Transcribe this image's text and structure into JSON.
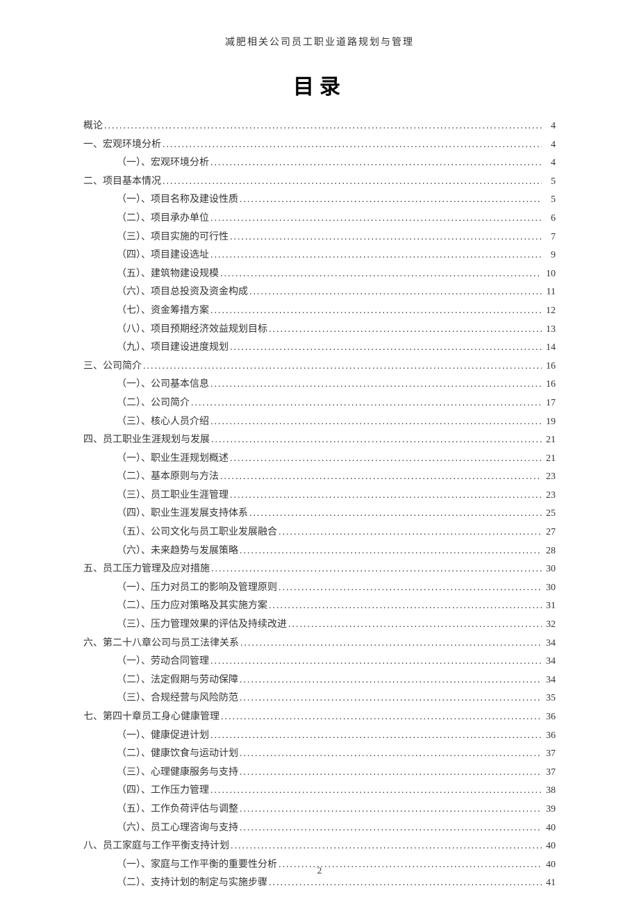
{
  "header_title": "减肥相关公司员工职业道路规划与管理",
  "main_title": "目录",
  "page_number": "2",
  "toc": [
    {
      "level": 0,
      "label": "概论",
      "page": "4"
    },
    {
      "level": 0,
      "label": "一、宏观环境分析",
      "page": "4"
    },
    {
      "level": 1,
      "label": "（一）、宏观环境分析",
      "page": "4"
    },
    {
      "level": 0,
      "label": "二、项目基本情况",
      "page": "5"
    },
    {
      "level": 1,
      "label": "（一）、项目名称及建设性质",
      "page": "5"
    },
    {
      "level": 1,
      "label": "（二）、项目承办单位",
      "page": "6"
    },
    {
      "level": 1,
      "label": "（三）、项目实施的可行性",
      "page": "7"
    },
    {
      "level": 1,
      "label": "（四）、项目建设选址",
      "page": "9"
    },
    {
      "level": 1,
      "label": "（五）、建筑物建设规模",
      "page": "10"
    },
    {
      "level": 1,
      "label": "（六）、项目总投资及资金构成",
      "page": "11"
    },
    {
      "level": 1,
      "label": "（七）、资金筹措方案",
      "page": "12"
    },
    {
      "level": 1,
      "label": "（八）、项目预期经济效益规划目标",
      "page": "13"
    },
    {
      "level": 1,
      "label": "（九）、项目建设进度规划",
      "page": "14"
    },
    {
      "level": 0,
      "label": "三、公司简介",
      "page": "16"
    },
    {
      "level": 1,
      "label": "（一）、公司基本信息",
      "page": "16"
    },
    {
      "level": 1,
      "label": "（二）、公司简介",
      "page": "17"
    },
    {
      "level": 1,
      "label": "（三）、核心人员介绍",
      "page": "19"
    },
    {
      "level": 0,
      "label": "四、员工职业生涯规划与发展",
      "page": "21"
    },
    {
      "level": 1,
      "label": "（一）、职业生涯规划概述",
      "page": "21"
    },
    {
      "level": 1,
      "label": "（二）、基本原则与方法",
      "page": "23"
    },
    {
      "level": 1,
      "label": "（三）、员工职业生涯管理",
      "page": "23"
    },
    {
      "level": 1,
      "label": "（四）、职业生涯发展支持体系",
      "page": "25"
    },
    {
      "level": 1,
      "label": "（五）、公司文化与员工职业发展融合",
      "page": "27"
    },
    {
      "level": 1,
      "label": "（六）、未来趋势与发展策略",
      "page": "28"
    },
    {
      "level": 0,
      "label": "五、员工压力管理及应对措施",
      "page": "30"
    },
    {
      "level": 1,
      "label": "（一）、压力对员工的影响及管理原则",
      "page": "30"
    },
    {
      "level": 1,
      "label": "（二）、压力应对策略及其实施方案",
      "page": "31"
    },
    {
      "level": 1,
      "label": "（三）、压力管理效果的评估及持续改进",
      "page": "32"
    },
    {
      "level": 0,
      "label": "六、第二十八章公司与员工法律关系",
      "page": "34"
    },
    {
      "level": 1,
      "label": "（一）、劳动合同管理",
      "page": "34"
    },
    {
      "level": 1,
      "label": "（二）、法定假期与劳动保障",
      "page": "34"
    },
    {
      "level": 1,
      "label": "（三）、合规经营与风险防范",
      "page": "35"
    },
    {
      "level": 0,
      "label": "七、第四十章员工身心健康管理",
      "page": "36"
    },
    {
      "level": 1,
      "label": "（一）、健康促进计划",
      "page": "36"
    },
    {
      "level": 1,
      "label": "（二）、健康饮食与运动计划",
      "page": "37"
    },
    {
      "level": 1,
      "label": "（三）、心理健康服务与支持",
      "page": "37"
    },
    {
      "level": 1,
      "label": "（四）、工作压力管理",
      "page": "38"
    },
    {
      "level": 1,
      "label": "（五）、工作负荷评估与调整",
      "page": "39"
    },
    {
      "level": 1,
      "label": "（六）、员工心理咨询与支持",
      "page": "40"
    },
    {
      "level": 0,
      "label": "八、员工家庭与工作平衡支持计划",
      "page": "40"
    },
    {
      "level": 1,
      "label": "（一）、家庭与工作平衡的重要性分析",
      "page": "40"
    },
    {
      "level": 1,
      "label": "（二）、支持计划的制定与实施步骤",
      "page": "41"
    }
  ]
}
